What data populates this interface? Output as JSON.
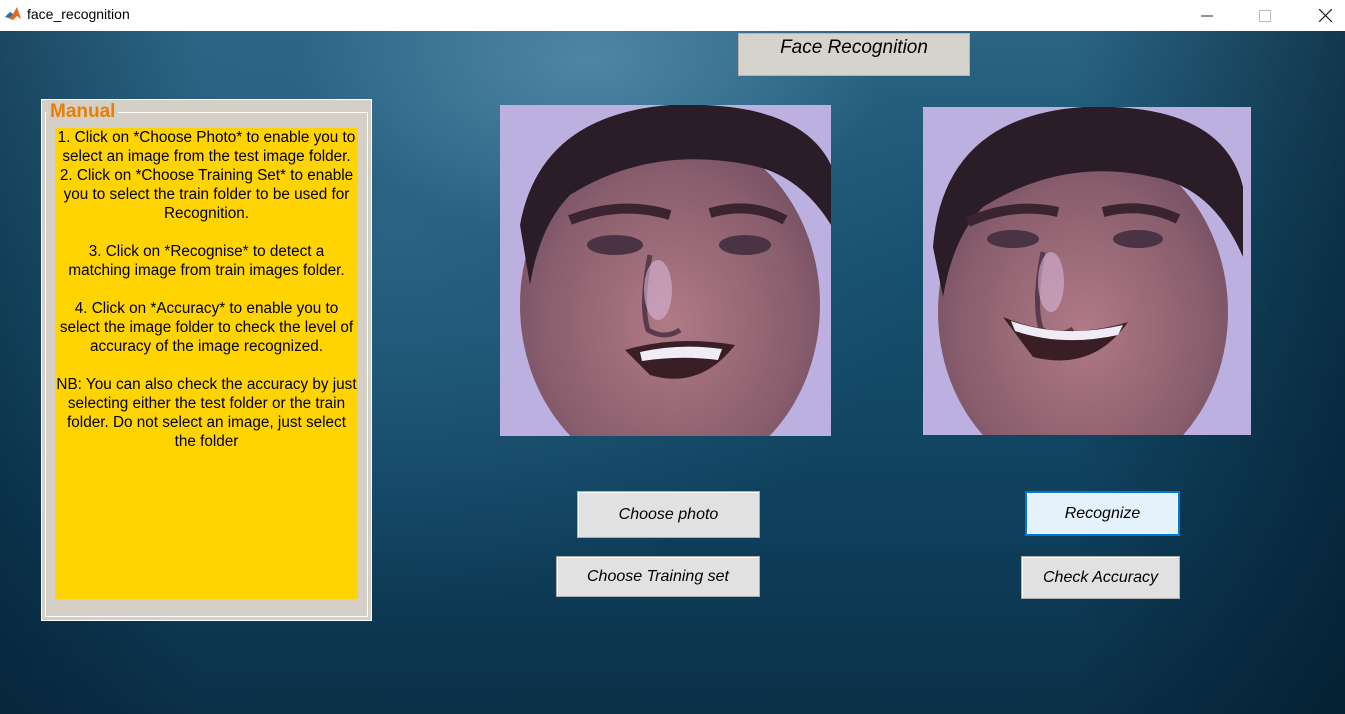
{
  "window": {
    "title": "face_recognition",
    "app_icon": "matlab-icon",
    "controls": {
      "minimize": "─",
      "maximize": "☐",
      "close": "✕"
    }
  },
  "header": {
    "title": "Face Recognition"
  },
  "manual": {
    "legend": "Manual",
    "text": "1. Click on *Choose Photo* to enable you to select an image from the test image folder.\n2. Click on *Choose Training Set* to enable you to select the train folder to be used for Recognition.\n\n3. Click on *Recognise* to detect a matching image from train images folder.\n\n4. Click on *Accuracy* to enable you to select the image folder to check the level of accuracy of the image recognized.\n\nNB: You can also check the accuracy by just selecting either the test folder or the train folder. Do not select an image, just select the folder",
    "background_color": "#ffd400",
    "legend_color": "#e87e04"
  },
  "images": {
    "test": "test-face-photo",
    "match": "matched-face-photo"
  },
  "buttons": {
    "choose_photo": "Choose photo",
    "choose_training_set": "Choose Training set",
    "recognize": "Recognize",
    "check_accuracy": "Check Accuracy"
  }
}
